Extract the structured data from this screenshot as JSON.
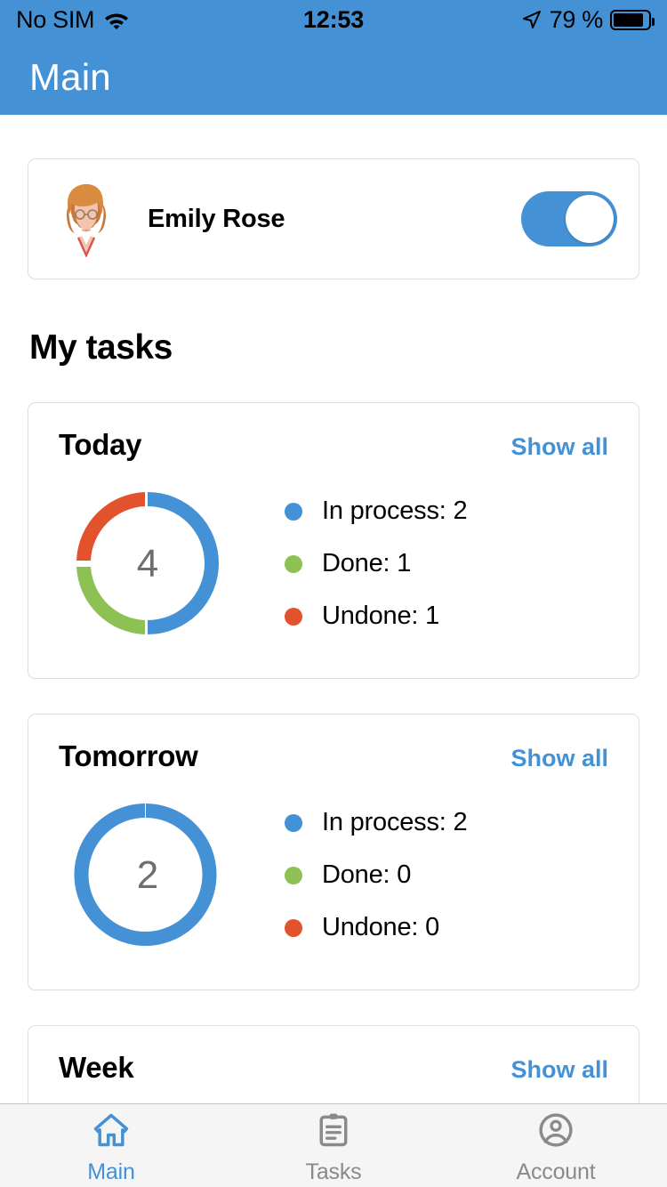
{
  "status_bar": {
    "carrier": "No SIM",
    "wifi_icon": "wifi-icon",
    "time": "12:53",
    "location_icon": "location-arrow-icon",
    "battery_percent": "79 %",
    "battery_icon": "battery-icon"
  },
  "header": {
    "title": "Main",
    "background_color": "#4591D5"
  },
  "profile": {
    "avatar_icon": "user-avatar-illustration",
    "name": "Emily Rose",
    "toggle_on": true,
    "toggle_color": "#4591D5"
  },
  "section": {
    "title": "My tasks"
  },
  "colors": {
    "in_process": "#4591D5",
    "done": "#8DC153",
    "undone": "#E2522C",
    "link": "#4591D5",
    "center_number": "#6E6E6E"
  },
  "cards": [
    {
      "title": "Today",
      "show_all": "Show all",
      "total": "4",
      "legend": [
        {
          "label": "In process: 2",
          "color": "#4591D5"
        },
        {
          "label": "Done: 1",
          "color": "#8DC153"
        },
        {
          "label": "Undone: 1",
          "color": "#E2522C"
        }
      ]
    },
    {
      "title": "Tomorrow",
      "show_all": "Show all",
      "total": "2",
      "legend": [
        {
          "label": "In process: 2",
          "color": "#4591D5"
        },
        {
          "label": "Done: 0",
          "color": "#8DC153"
        },
        {
          "label": "Undone: 0",
          "color": "#E2522C"
        }
      ]
    },
    {
      "title": "Week",
      "show_all": "Show all"
    }
  ],
  "chart_data": [
    {
      "type": "pie",
      "title": "Today",
      "center_label": "4",
      "labels": [
        "In process",
        "Done",
        "Undone"
      ],
      "values": [
        2,
        1,
        1
      ],
      "colors": [
        "#4591D5",
        "#8DC153",
        "#E2522C"
      ],
      "total": 4,
      "legend_position": "right",
      "donut": true
    },
    {
      "type": "pie",
      "title": "Tomorrow",
      "center_label": "2",
      "labels": [
        "In process",
        "Done",
        "Undone"
      ],
      "values": [
        2,
        0,
        0
      ],
      "colors": [
        "#4591D5",
        "#8DC153",
        "#E2522C"
      ],
      "total": 2,
      "legend_position": "right",
      "donut": true
    }
  ],
  "tabbar": {
    "items": [
      {
        "label": "Main",
        "icon": "home-icon",
        "active": true
      },
      {
        "label": "Tasks",
        "icon": "clipboard-icon",
        "active": false
      },
      {
        "label": "Account",
        "icon": "account-circle-icon",
        "active": false
      }
    ]
  }
}
